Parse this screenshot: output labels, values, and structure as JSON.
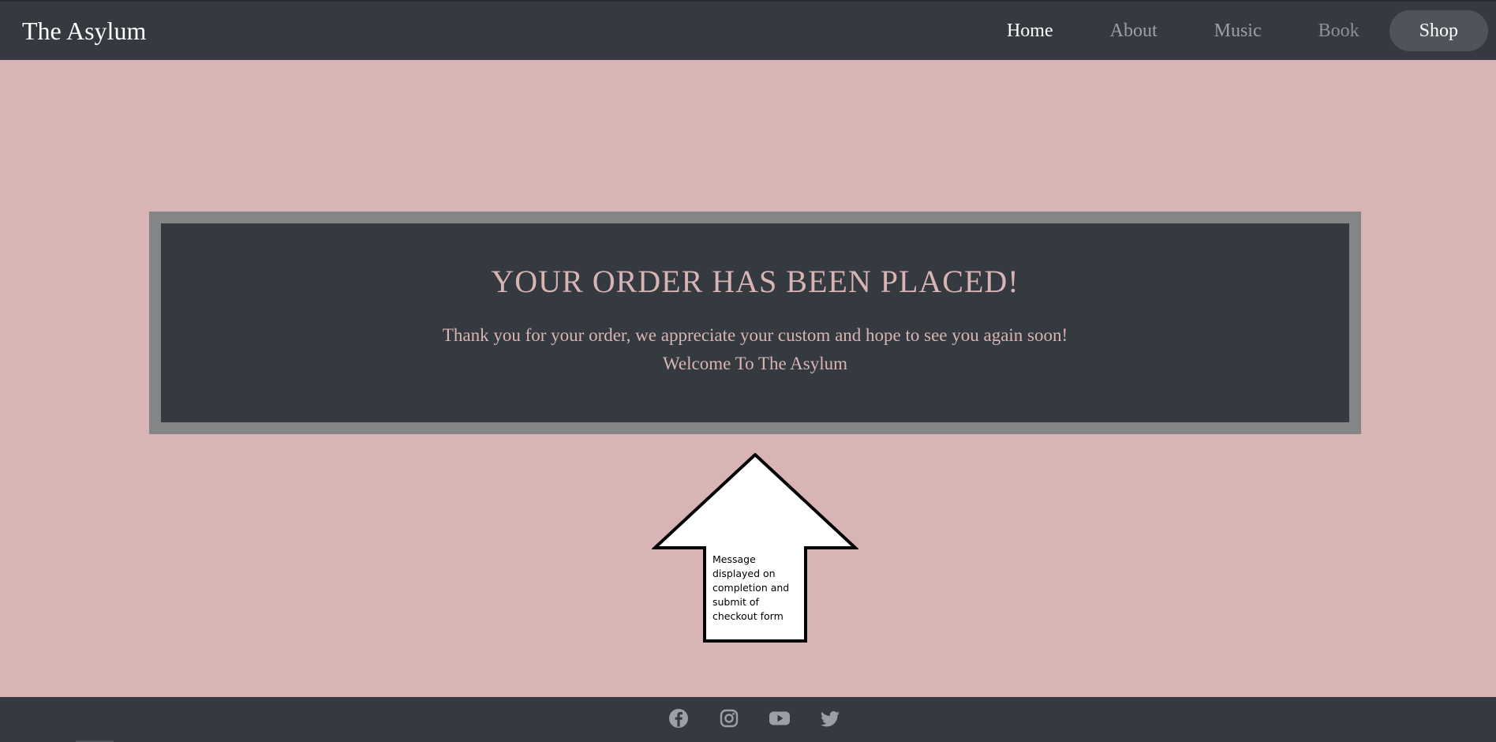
{
  "navbar": {
    "brand": "The Asylum",
    "items": [
      {
        "label": "Home"
      },
      {
        "label": "About"
      },
      {
        "label": "Music"
      },
      {
        "label": "Book"
      },
      {
        "label": "Shop"
      }
    ]
  },
  "confirmation": {
    "title": "YOUR ORDER HAS BEEN PLACED!",
    "message_line1": "Thank you for your order, we appreciate your custom and hope to see you again soon!",
    "message_line2": "Welcome To The Asylum"
  },
  "annotation": {
    "line1": "Message",
    "line2": "displayed on",
    "line3": "completion and",
    "line4": "submit of",
    "line5": "checkout form"
  },
  "footer": {
    "socials": [
      {
        "icon": "facebook-icon"
      },
      {
        "icon": "instagram-icon"
      },
      {
        "icon": "youtube-icon"
      },
      {
        "icon": "twitter-icon"
      }
    ]
  },
  "colors": {
    "background": "#d9b4b5",
    "navbar": "#343a40",
    "card_border": "#838586",
    "card_text": "#d9b4b5",
    "active_pill": "#4f545a",
    "social_icon": "#9aa0a6"
  }
}
